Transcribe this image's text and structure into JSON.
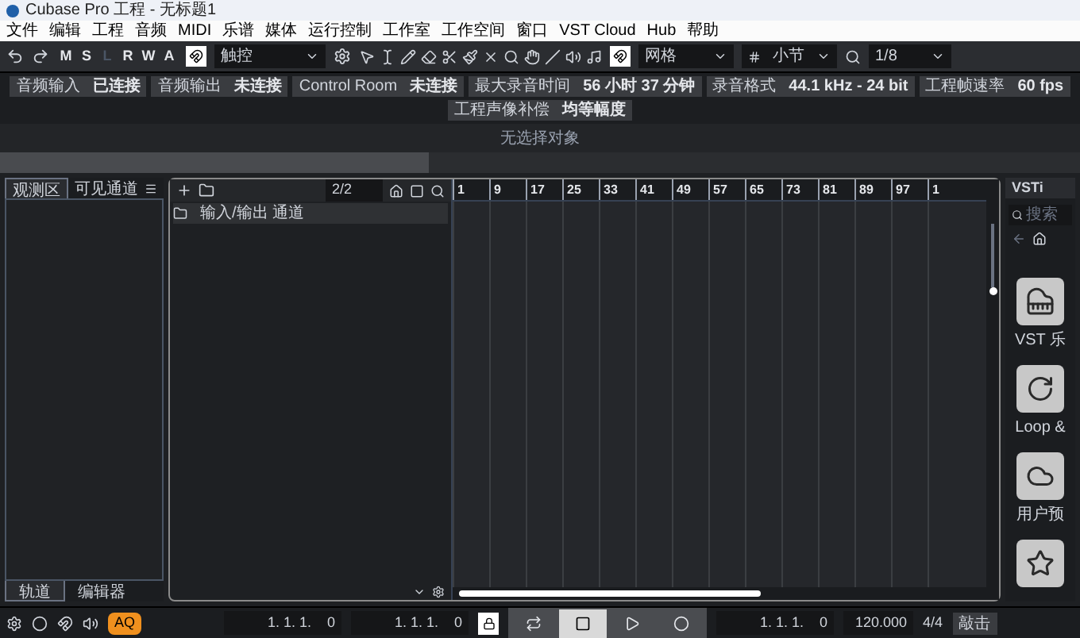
{
  "window": {
    "title": "Cubase Pro 工程 - 无标题1"
  },
  "menu": [
    "文件",
    "编辑",
    "工程",
    "音频",
    "MIDI",
    "乐谱",
    "媒体",
    "运行控制",
    "工作室",
    "工作空间",
    "窗口",
    "VST Cloud",
    "Hub",
    "帮助"
  ],
  "toolbar": {
    "modes": [
      {
        "label": "M",
        "disabled": false
      },
      {
        "label": "S",
        "disabled": false
      },
      {
        "label": "L",
        "disabled": true
      },
      {
        "label": "R",
        "disabled": false
      },
      {
        "label": "W",
        "disabled": false
      },
      {
        "label": "A",
        "disabled": false
      }
    ],
    "automation_mode": "触控",
    "snap_type": "网格",
    "grid_type": "小节",
    "quantize": "1/8"
  },
  "status": [
    {
      "label": "音频输入",
      "value": "已连接"
    },
    {
      "label": "音频输出",
      "value": "未连接"
    },
    {
      "label": "Control Room",
      "value": "未连接"
    },
    {
      "label": "最大录音时间",
      "value": "56 小时 37 分钟"
    },
    {
      "label": "录音格式",
      "value": "44.1 kHz - 24 bit"
    },
    {
      "label": "工程帧速率",
      "value": "60 fps"
    },
    {
      "label": "工程声像补偿",
      "value": "均等幅度"
    }
  ],
  "info_line": "无选择对象",
  "left_zone": {
    "tabs": [
      {
        "label": "观测区",
        "selected": true
      },
      {
        "label": "可见通道",
        "selected": false
      }
    ],
    "bottom_tabs": [
      {
        "label": "轨道",
        "selected": true
      },
      {
        "label": "编辑器",
        "selected": false
      }
    ]
  },
  "track_list": {
    "counter": "2/2",
    "tracks": [
      {
        "name": "输入/输出 通道"
      }
    ]
  },
  "ruler": [
    "1",
    "9",
    "17",
    "25",
    "33",
    "41",
    "49",
    "57",
    "65",
    "73",
    "81",
    "89",
    "97",
    "1"
  ],
  "right_zone": {
    "tabs": [
      {
        "label": "VSTi",
        "selected": true
      }
    ],
    "search": {
      "placeholder": "搜索"
    },
    "tiles": [
      {
        "label": "VST 乐",
        "kind": "piano"
      },
      {
        "label": "Loop &",
        "kind": "loop"
      },
      {
        "label": "用户预",
        "kind": "user"
      },
      {
        "kind": "star"
      }
    ]
  },
  "transport": {
    "aq": {
      "label": "AQ",
      "on": true
    },
    "left_locator": "1. 1. 1.    0",
    "right_locator": "1. 1. 1.    0",
    "lock": {
      "on": true
    },
    "controls": [
      {
        "kind": "cycle",
        "selected": false
      },
      {
        "kind": "stop",
        "selected": true
      },
      {
        "kind": "play",
        "selected": false
      },
      {
        "kind": "record",
        "selected": false
      }
    ],
    "position": "1. 1. 1.    0",
    "tempo": "120.000",
    "signature": "4/4",
    "tap": "敲击"
  }
}
